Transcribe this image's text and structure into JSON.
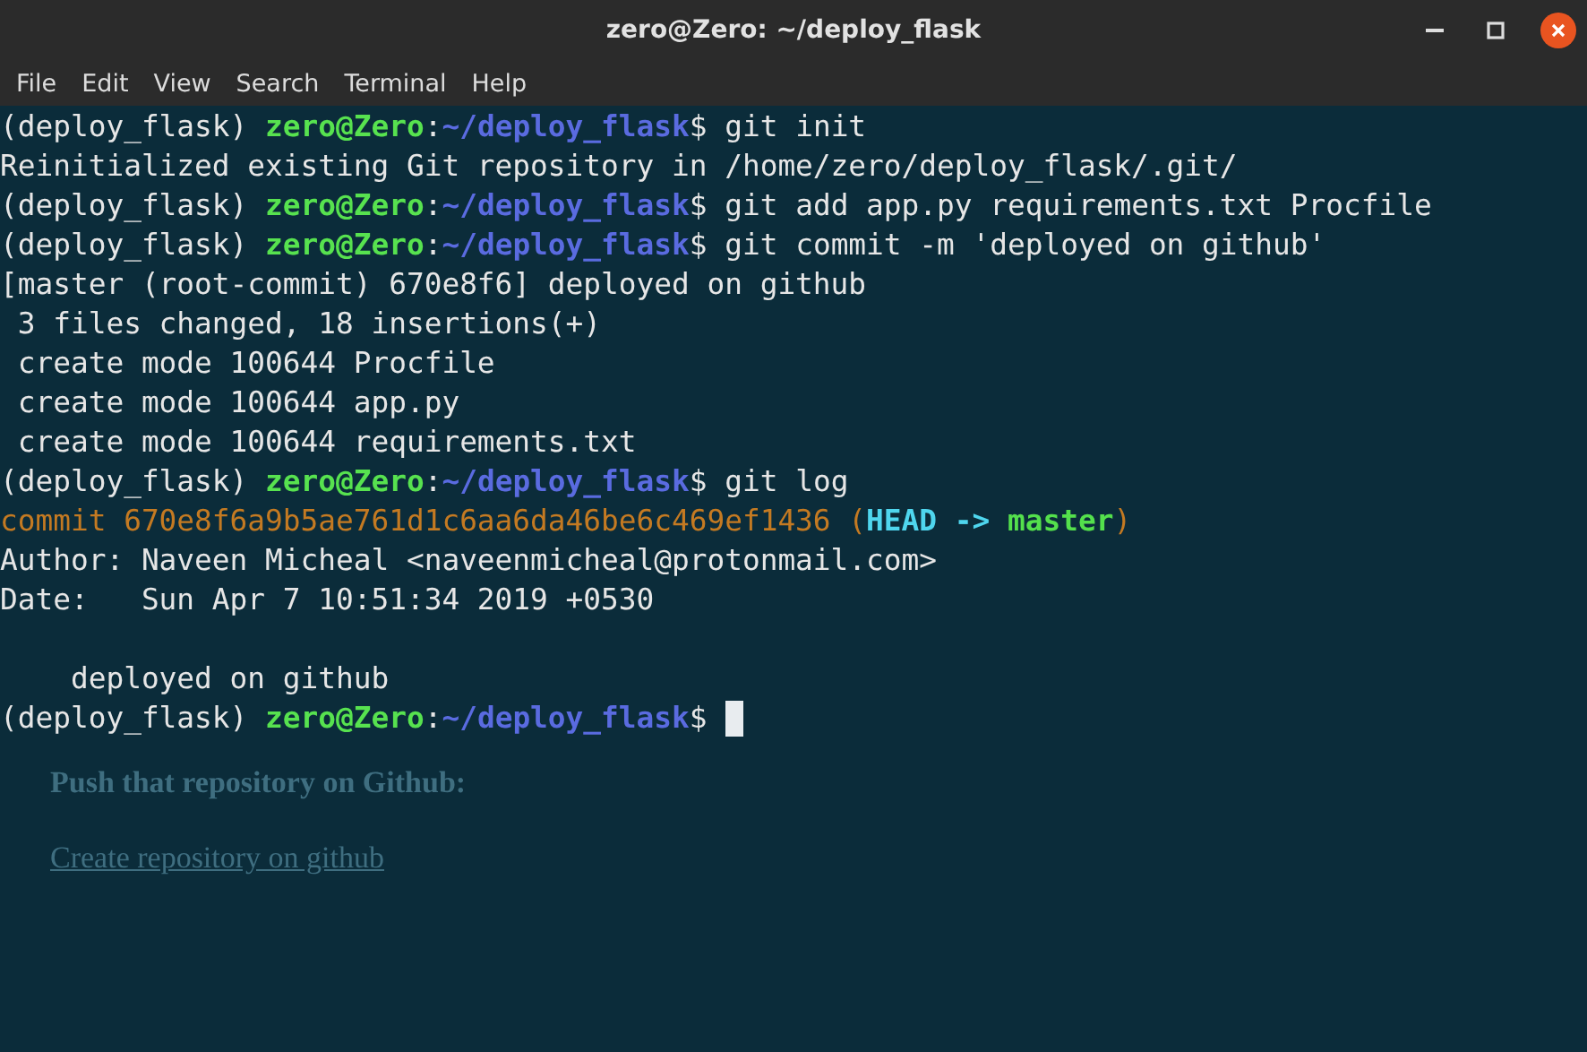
{
  "window": {
    "title": "zero@Zero: ~/deploy_flask"
  },
  "menu": [
    "File",
    "Edit",
    "View",
    "Search",
    "Terminal",
    "Help"
  ],
  "terminal": {
    "lines": [
      {
        "kind": "text",
        "segments": [
          {
            "kind": "plain",
            "text": "(deploy_flask) "
          },
          {
            "kind": "user",
            "text": "zero@Zero"
          },
          {
            "kind": "plain",
            "text": ":"
          },
          {
            "kind": "path",
            "text": "~/deploy_flask"
          },
          {
            "kind": "plain",
            "text": "$ git init"
          }
        ]
      },
      {
        "kind": "text",
        "segments": [
          {
            "kind": "plain",
            "text": "Reinitialized existing Git repository in /home/zero/deploy_flask/.git/"
          }
        ]
      },
      {
        "kind": "text",
        "segments": [
          {
            "kind": "plain",
            "text": "(deploy_flask) "
          },
          {
            "kind": "user",
            "text": "zero@Zero"
          },
          {
            "kind": "plain",
            "text": ":"
          },
          {
            "kind": "path",
            "text": "~/deploy_flask"
          },
          {
            "kind": "plain",
            "text": "$ git add app.py requirements.txt Procfile"
          }
        ]
      },
      {
        "kind": "text",
        "segments": [
          {
            "kind": "plain",
            "text": "(deploy_flask) "
          },
          {
            "kind": "user",
            "text": "zero@Zero"
          },
          {
            "kind": "plain",
            "text": ":"
          },
          {
            "kind": "path",
            "text": "~/deploy_flask"
          },
          {
            "kind": "plain",
            "text": "$ git commit -m 'deployed on github'"
          }
        ]
      },
      {
        "kind": "text",
        "segments": [
          {
            "kind": "plain",
            "text": "[master (root-commit) 670e8f6] deployed on github"
          }
        ]
      },
      {
        "kind": "text",
        "segments": [
          {
            "kind": "plain",
            "text": " 3 files changed, 18 insertions(+)"
          }
        ]
      },
      {
        "kind": "text",
        "segments": [
          {
            "kind": "plain",
            "text": " create mode 100644 Procfile"
          }
        ]
      },
      {
        "kind": "text",
        "segments": [
          {
            "kind": "plain",
            "text": " create mode 100644 app.py"
          }
        ]
      },
      {
        "kind": "text",
        "segments": [
          {
            "kind": "plain",
            "text": " create mode 100644 requirements.txt"
          }
        ]
      },
      {
        "kind": "text",
        "segments": [
          {
            "kind": "plain",
            "text": "(deploy_flask) "
          },
          {
            "kind": "user",
            "text": "zero@Zero"
          },
          {
            "kind": "plain",
            "text": ":"
          },
          {
            "kind": "path",
            "text": "~/deploy_flask"
          },
          {
            "kind": "plain",
            "text": "$ git log"
          }
        ]
      },
      {
        "kind": "text",
        "segments": [
          {
            "kind": "commit",
            "text": "commit 670e8f6a9b5ae761d1c6aa6da46be6c469ef1436 ("
          },
          {
            "kind": "head",
            "text": "HEAD -> "
          },
          {
            "kind": "branch",
            "text": "master"
          },
          {
            "kind": "commit",
            "text": ")"
          }
        ]
      },
      {
        "kind": "text",
        "segments": [
          {
            "kind": "plain",
            "text": "Author: Naveen Micheal <naveenmicheal@protonmail.com>"
          }
        ]
      },
      {
        "kind": "text",
        "segments": [
          {
            "kind": "plain",
            "text": "Date:   Sun Apr 7 10:51:34 2019 +0530"
          }
        ]
      },
      {
        "kind": "blank"
      },
      {
        "kind": "text",
        "segments": [
          {
            "kind": "plain",
            "text": "    deployed on github"
          }
        ]
      },
      {
        "kind": "text",
        "segments": [
          {
            "kind": "plain",
            "text": "(deploy_flask) "
          },
          {
            "kind": "user",
            "text": "zero@Zero"
          },
          {
            "kind": "plain",
            "text": ":"
          },
          {
            "kind": "path",
            "text": "~/deploy_flask"
          },
          {
            "kind": "plain",
            "text": "$ "
          }
        ],
        "cursor": true
      }
    ]
  },
  "background_page": [
    "Push that repository on Github:",
    "Create repository on github"
  ]
}
